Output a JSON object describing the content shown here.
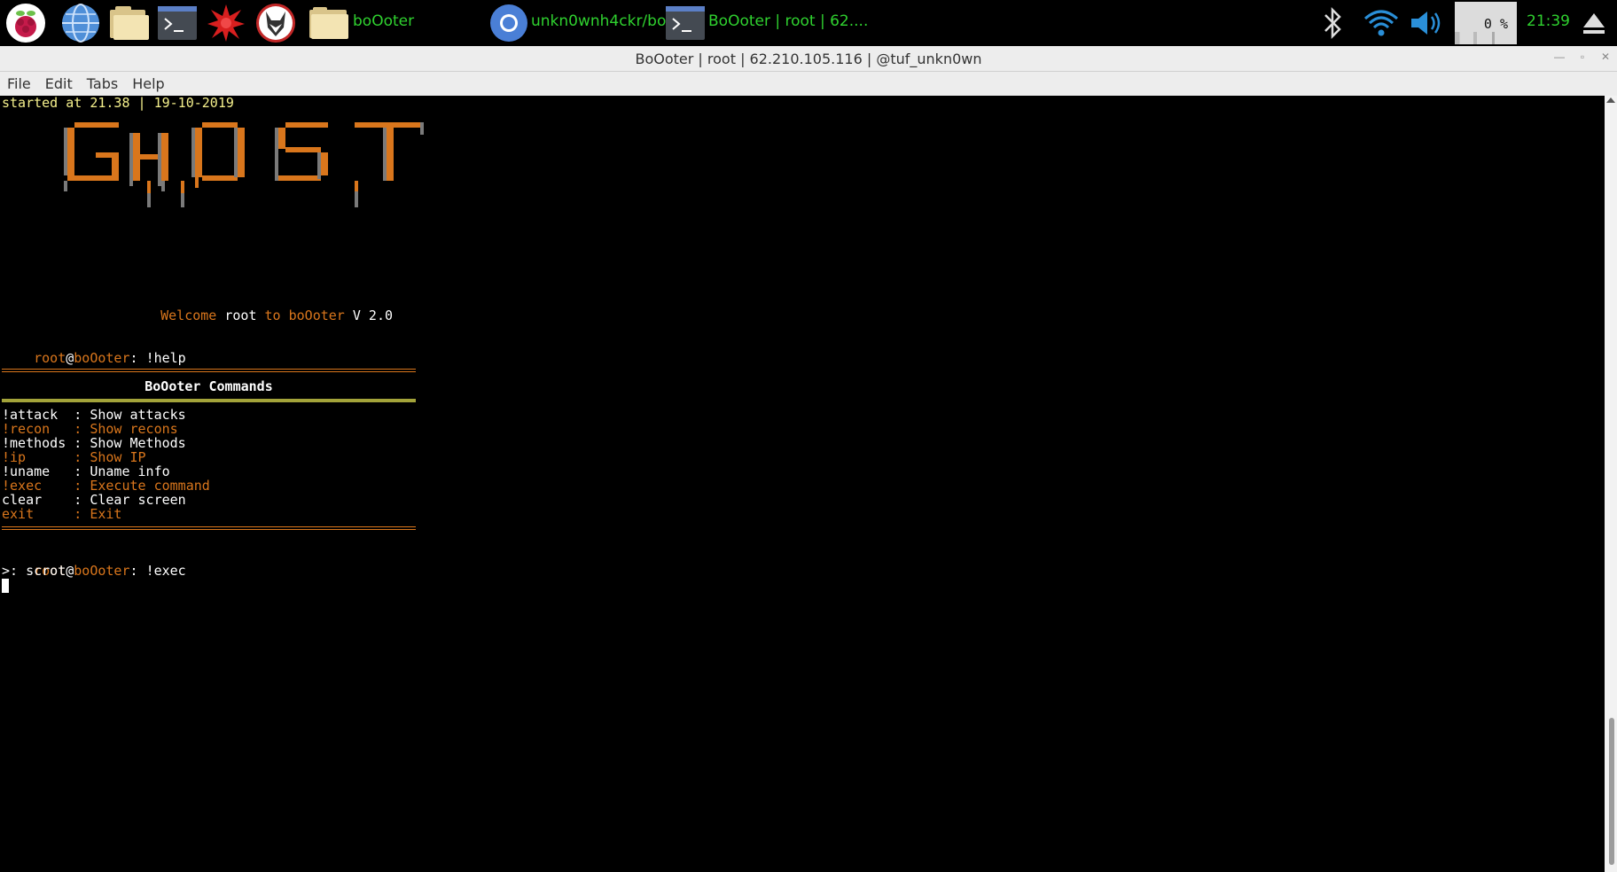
{
  "taskbar": {
    "icons": [
      "raspberry-menu-icon",
      "web-browser-icon",
      "file-manager-icon",
      "terminal-icon",
      "burst-app-icon",
      "wolf-app-icon"
    ],
    "tasks": [
      {
        "label": "boOoter",
        "icon": "folder-icon"
      },
      {
        "label": "unkn0wnh4ckr/bo...",
        "icon": "chromium-icon"
      },
      {
        "label": "BoOoter | root | 62....",
        "icon": "terminal-icon"
      }
    ],
    "cpu": "0 %",
    "clock": "21:39"
  },
  "window": {
    "title": "BoOoter | root | 62.210.105.116 | @tuf_unkn0wn"
  },
  "menu": [
    "File",
    "Edit",
    "Tabs",
    "Help"
  ],
  "terminal": {
    "started": "started at 21.38 | 19-10-2019",
    "welcome": {
      "w1": "Welcome ",
      "user": "root",
      "w2": " to boOoter",
      "ver": " V 2.0"
    },
    "prompt1": {
      "user": "root",
      "at": "@",
      "host": "boOoter",
      "colon": ": ",
      "cmd": "!help"
    },
    "commands_title": "BoOoter Commands",
    "commands": [
      {
        "text": "!attack  : Show attacks",
        "color": "white"
      },
      {
        "text": "!recon   : Show recons",
        "color": "orange"
      },
      {
        "text": "!methods : Show Methods",
        "color": "white"
      },
      {
        "text": "!ip      : Show IP",
        "color": "orange"
      },
      {
        "text": "!uname   : Uname info",
        "color": "white"
      },
      {
        "text": "!exec    : Execute command",
        "color": "orange"
      },
      {
        "text": "clear    : Clear screen",
        "color": "white"
      },
      {
        "text": "exit     : Exit",
        "color": "orange"
      }
    ],
    "prompt2": {
      "user": "root",
      "at": "@",
      "host": "boOoter",
      "colon": ": ",
      "cmd": "!exec"
    },
    "exec_input": ">: scrot"
  }
}
